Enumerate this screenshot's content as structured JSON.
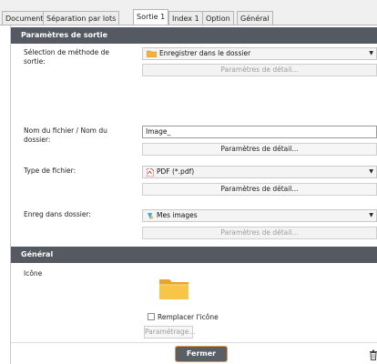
{
  "tabs": [
    {
      "label": "Document"
    },
    {
      "label": "Séparation par lots"
    },
    {
      "label": "Sortie 1"
    },
    {
      "label": "Index 1"
    },
    {
      "label": "Option"
    },
    {
      "label": "Général"
    }
  ],
  "active_tab": "Sortie 1",
  "output_section": {
    "header": "Paramètres de sortie",
    "method": {
      "label": "Sélection de méthode de sortie:",
      "value": "Enregistrer dans le dossier",
      "detail_button": "Paramètres de détail..."
    },
    "filename": {
      "label": "Nom du fichier / Nom du dossier:",
      "value": "Image_",
      "detail_button": "Paramètres de détail..."
    },
    "filetype": {
      "label": "Type de fichier:",
      "value": "PDF (*.pdf)",
      "detail_button": "Paramètres de détail..."
    },
    "save_folder": {
      "label": "Enreg dans dossier:",
      "value": "Mes images",
      "detail_button": "Paramètres de détail..."
    }
  },
  "general_section": {
    "header": "Général",
    "icon_label": "Icône",
    "icon_name": "folder-icon",
    "replace_icon_label": "Remplacer l'icône",
    "replace_icon_checked": false,
    "settings_button": "Paramétrage..."
  },
  "footer": {
    "close_button": "Fermer"
  },
  "colors": {
    "header_bg": "#555a62",
    "close_border": "#e49a43"
  }
}
